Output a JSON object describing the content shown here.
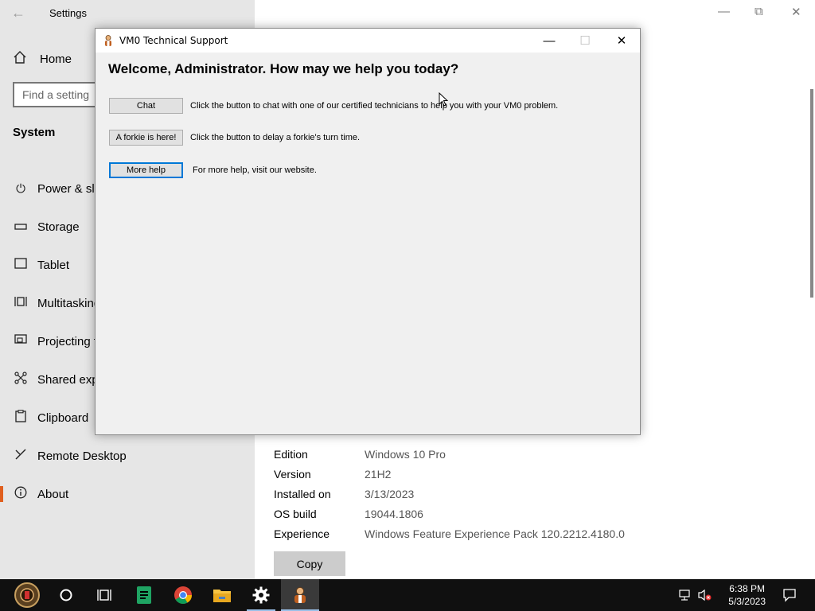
{
  "settings": {
    "app_title": "Settings",
    "home_label": "Home",
    "search_placeholder": "Find a setting",
    "section_title": "System",
    "nav": [
      {
        "label": "Power & sle",
        "icon": "power-icon"
      },
      {
        "label": "Storage",
        "icon": "storage-icon"
      },
      {
        "label": "Tablet",
        "icon": "tablet-icon"
      },
      {
        "label": "Multitasking",
        "icon": "multitasking-icon"
      },
      {
        "label": "Projecting t",
        "icon": "projecting-icon"
      },
      {
        "label": "Shared expe",
        "icon": "shared-experiences-icon"
      },
      {
        "label": "Clipboard",
        "icon": "clipboard-icon"
      },
      {
        "label": "Remote Desktop",
        "icon": "remote-desktop-icon"
      },
      {
        "label": "About",
        "icon": "info-icon"
      }
    ],
    "about": [
      {
        "key": "Edition",
        "value": "Windows 10 Pro"
      },
      {
        "key": "Version",
        "value": "21H2"
      },
      {
        "key": "Installed on",
        "value": "3/13/2023"
      },
      {
        "key": "OS build",
        "value": "19044.1806"
      },
      {
        "key": "Experience",
        "value": "Windows Feature Experience Pack 120.2212.4180.0"
      }
    ],
    "copy_label": "Copy"
  },
  "dialog": {
    "title": "VM0 Technical Support",
    "welcome": "Welcome, Administrator. How may we help you today?",
    "rows": [
      {
        "button": "Chat",
        "text": "Click the button to chat with one of our certified technicians to help you with your VM0 problem."
      },
      {
        "button": "A forkie is here!",
        "text": "Click the button to delay a forkie's turn time."
      },
      {
        "button": "More help",
        "text": "For more help, visit our website."
      }
    ]
  },
  "taskbar": {
    "time": "6:38 PM",
    "date": "5/3/2023"
  },
  "colors": {
    "accent": "#0078d7",
    "active_nav_marker": "#e05f1e",
    "taskbar_bg": "#101010"
  }
}
